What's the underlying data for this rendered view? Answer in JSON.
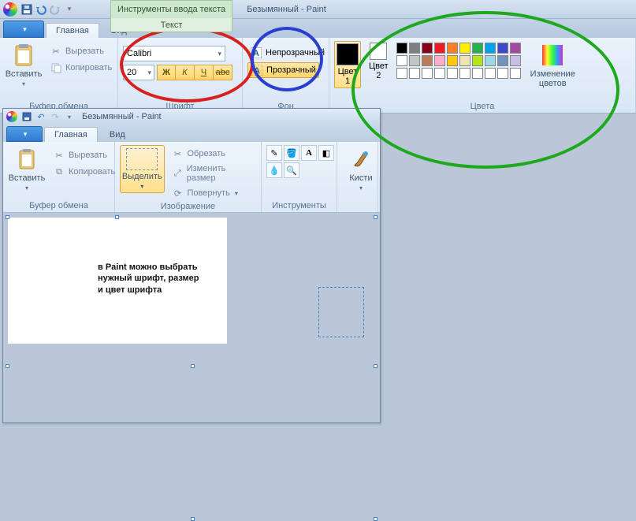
{
  "outer": {
    "context_tab_upper": "Инструменты ввода текста",
    "context_tab_lower": "Текст",
    "title": "Безымянный - Paint",
    "tabs": {
      "home": "Главная",
      "view": "Вид"
    },
    "qat_tooltip_save": "save",
    "qat_tooltip_undo": "undo",
    "qat_tooltip_redo": "redo"
  },
  "clipboard": {
    "paste": "Вставить",
    "cut": "Вырезать",
    "copy": "Копировать",
    "group": "Буфер обмена"
  },
  "font": {
    "family": "Calibri",
    "size": "20",
    "bold": "Ж",
    "italic": "К",
    "underline": "Ч",
    "strike": "abc",
    "group": "Шрифт"
  },
  "bg": {
    "opaque": "Непрозрачный",
    "transparent": "Прозрачный",
    "group": "Фон"
  },
  "colors": {
    "color1": "Цвет\n1",
    "color2": "Цвет\n2",
    "edit": "Изменение\nцветов",
    "group": "Цвета",
    "color1_hex": "#000000",
    "color2_hex": "#ffffff",
    "row1": [
      "#000000",
      "#7f7f7f",
      "#880015",
      "#ed1c24",
      "#ff7f27",
      "#fff200",
      "#22b14c",
      "#00a2e8",
      "#3f48cc",
      "#a349a4"
    ],
    "row2": [
      "#ffffff",
      "#c3c3c3",
      "#b97a57",
      "#ffaec9",
      "#ffc90e",
      "#efe4b0",
      "#b5e61d",
      "#99d9ea",
      "#7092be",
      "#c8bfe7"
    ],
    "row3": [
      "#ffffff",
      "#ffffff",
      "#ffffff",
      "#ffffff",
      "#ffffff",
      "#ffffff",
      "#ffffff",
      "#ffffff",
      "#ffffff",
      "#ffffff"
    ]
  },
  "inner": {
    "title": "Безымянный - Paint",
    "tabs": {
      "home": "Главная",
      "view": "Вид"
    },
    "clipboard": {
      "paste": "Вставить",
      "cut": "Вырезать",
      "copy": "Копировать",
      "group": "Буфер обмена"
    },
    "image": {
      "select": "Выделить",
      "crop": "Обрезать",
      "resize": "Изменить размер",
      "rotate": "Повернуть",
      "group": "Изображение"
    },
    "tools": {
      "group": "Инструменты"
    },
    "brushes": {
      "label": "Кисти"
    }
  },
  "canvas_text": {
    "l1": "в Paint можно выбрать",
    "l2": "нужный шрифт, размер",
    "l3": "и цвет шрифта"
  }
}
